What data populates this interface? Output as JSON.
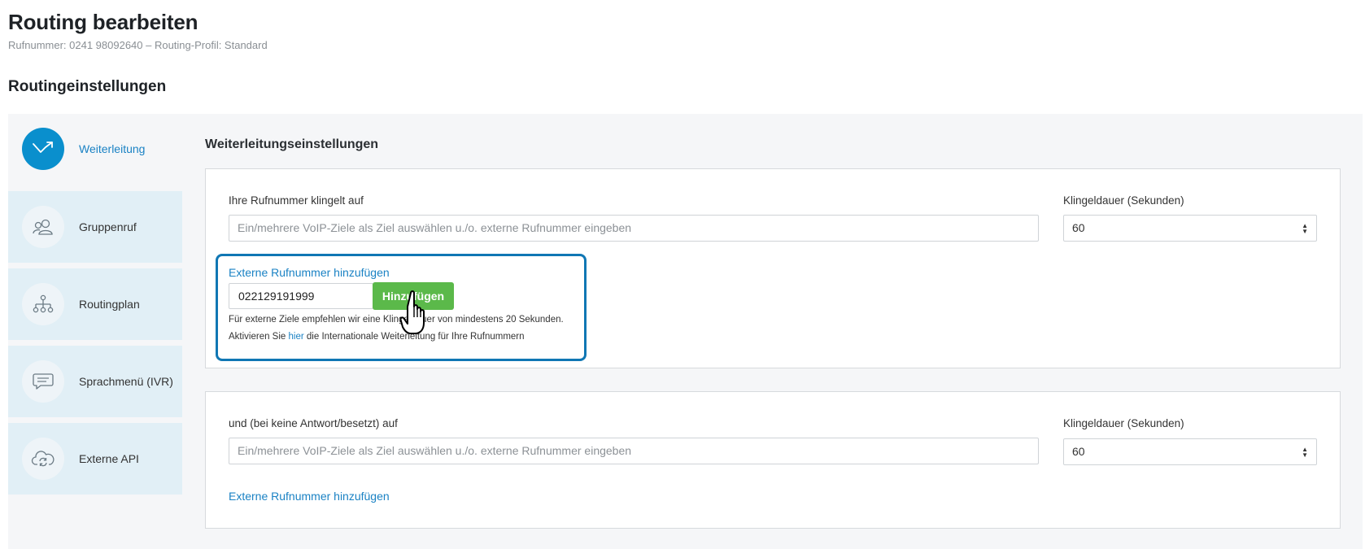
{
  "header": {
    "title": "Routing bearbeiten",
    "subtitle": "Rufnummer: 0241 98092640 – Routing-Profil: Standard"
  },
  "section": {
    "title": "Routingeinstellungen"
  },
  "sidebar": {
    "items": [
      {
        "label": "Weiterleitung",
        "icon": "forward-arrow-icon",
        "active": true
      },
      {
        "label": "Gruppenruf",
        "icon": "users-icon",
        "active": false
      },
      {
        "label": "Routingplan",
        "icon": "hierarchy-icon",
        "active": false
      },
      {
        "label": "Sprachmenü (IVR)",
        "icon": "chat-bubble-icon",
        "active": false
      },
      {
        "label": "Externe API",
        "icon": "cloud-sync-icon",
        "active": false
      }
    ]
  },
  "main": {
    "title": "Weiterleitungseinstellungen",
    "primary": {
      "ring_label": "Ihre Rufnummer klingelt auf",
      "target_placeholder": "Ein/mehrere VoIP-Ziele als Ziel auswählen u./o. externe Rufnummer eingeben",
      "duration_label": "Klingeldauer (Sekunden)",
      "duration_value": "60",
      "external_link": "Externe Rufnummer hinzufügen",
      "phone_value": "022129191999",
      "add_button": "Hinzufügen",
      "hint_line1": "Für externe Ziele empfehlen wir eine Klingeldauer von mindestens 20 Sekunden.",
      "hint_line2_before": "Aktivieren Sie ",
      "hint_line2_link": "hier",
      "hint_line2_after": " die Internationale Weiterleitung für Ihre Rufnummern"
    },
    "fallback": {
      "ring_label": "und (bei keine Antwort/besetzt) auf",
      "target_placeholder": "Ein/mehrere VoIP-Ziele als Ziel auswählen u./o. externe Rufnummer eingeben",
      "duration_label": "Klingeldauer (Sekunden)",
      "duration_value": "60",
      "external_link": "Externe Rufnummer hinzufügen"
    }
  },
  "colors": {
    "accent": "#1a82c4",
    "active_nav": "#0a8fcd",
    "nav_bg": "#e1eff6",
    "button_green": "#5bb94a",
    "highlight_border": "#1077b4"
  }
}
